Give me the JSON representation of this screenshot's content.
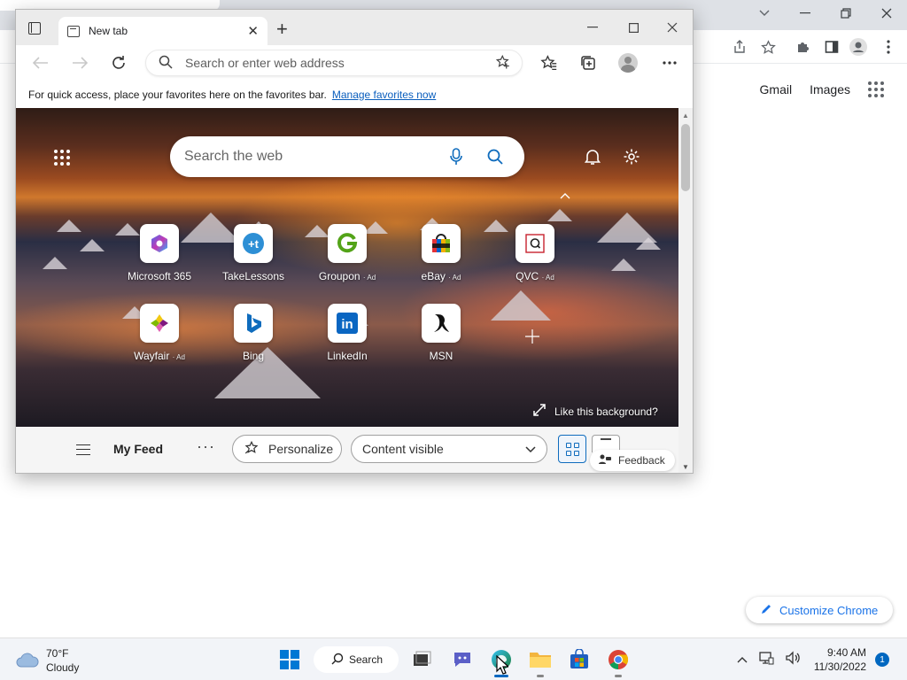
{
  "chrome": {
    "links": {
      "gmail": "Gmail",
      "images": "Images"
    },
    "customize_label": "Customize Chrome"
  },
  "edge": {
    "tab": {
      "title": "New tab"
    },
    "address": {
      "placeholder": "Search or enter web address"
    },
    "favbar": {
      "text": "For quick access, place your favorites here on the favorites bar.",
      "link": "Manage favorites now"
    },
    "ntp": {
      "search_placeholder": "Search the web",
      "tiles": [
        {
          "label": "Microsoft 365",
          "ad": "",
          "icon": "microsoft365-icon"
        },
        {
          "label": "TakeLessons",
          "ad": "",
          "icon": "takelessons-icon"
        },
        {
          "label": "Groupon",
          "ad": "· Ad",
          "icon": "groupon-icon"
        },
        {
          "label": "eBay",
          "ad": "· Ad",
          "icon": "ebay-icon"
        },
        {
          "label": "QVC",
          "ad": "· Ad",
          "icon": "qvc-icon"
        },
        {
          "label": "Wayfair",
          "ad": "· Ad",
          "icon": "wayfair-icon"
        },
        {
          "label": "Bing",
          "ad": "",
          "icon": "bing-icon"
        },
        {
          "label": "LinkedIn",
          "ad": "",
          "icon": "linkedin-icon"
        },
        {
          "label": "MSN",
          "ad": "",
          "icon": "msn-icon"
        }
      ],
      "like_background": "Like this background?"
    },
    "feed": {
      "title": "My Feed",
      "personalize": "Personalize",
      "content_select": "Content visible",
      "feedback": "Feedback"
    }
  },
  "taskbar": {
    "weather": {
      "temp": "70°F",
      "condition": "Cloudy"
    },
    "search_label": "Search",
    "clock": {
      "time": "9:40 AM",
      "date": "11/30/2022"
    },
    "notifications": "1"
  },
  "colors": {
    "edge_accent": "#0f6cbd",
    "chrome_accent": "#1a73e8",
    "taskbar_bg": "#f2f4f8"
  }
}
